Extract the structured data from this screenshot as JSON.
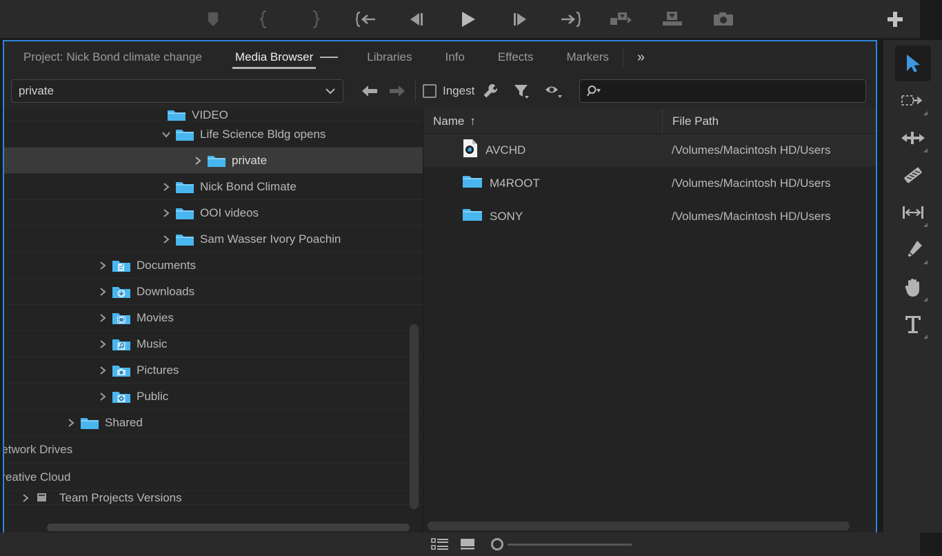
{
  "transport": {
    "buttons": [
      {
        "name": "add-marker-button",
        "icon": "marker-icon"
      },
      {
        "name": "mark-in-button",
        "icon": "mark-in-icon"
      },
      {
        "name": "mark-out-button",
        "icon": "mark-out-icon"
      },
      {
        "name": "go-to-in-button",
        "icon": "go-to-in-icon"
      },
      {
        "name": "step-back-button",
        "icon": "step-back-icon"
      },
      {
        "name": "play-stop-button",
        "icon": "play-icon"
      },
      {
        "name": "step-forward-button",
        "icon": "step-forward-icon"
      },
      {
        "name": "go-to-out-button",
        "icon": "go-to-out-icon"
      },
      {
        "name": "insert-button",
        "icon": "insert-icon"
      },
      {
        "name": "overwrite-button",
        "icon": "overwrite-icon"
      },
      {
        "name": "export-frame-button",
        "icon": "camera-icon"
      }
    ],
    "plus_label": "+"
  },
  "panel": {
    "tabs": [
      {
        "label": "Project: Nick Bond climate change",
        "active": false
      },
      {
        "label": "Media Browser",
        "active": true
      },
      {
        "label": "Libraries",
        "active": false
      },
      {
        "label": "Info",
        "active": false
      },
      {
        "label": "Effects",
        "active": false
      },
      {
        "label": "Markers",
        "active": false
      }
    ],
    "overflow_label": "»",
    "focus_border_color": "#2d85e0"
  },
  "toolbar": {
    "path_value": "private",
    "path_caret": "⌄",
    "back_label": "Back",
    "forward_label": "Forward",
    "ingest_label": "Ingest",
    "ingest_checked": false,
    "wrench_label": "Ingest Settings",
    "filter_label": "Filter by type",
    "eye_label": "Show hidden",
    "search_placeholder": ""
  },
  "tree": {
    "items": [
      {
        "label": "VIDEO",
        "indent": 9,
        "twisty": "down",
        "icon": "folder-blue",
        "selected": false,
        "clipped": true
      },
      {
        "label": "Life Science Bldg opens",
        "indent": 8,
        "twisty": "down",
        "icon": "folder-blue",
        "selected": false
      },
      {
        "label": "private",
        "indent": 9,
        "twisty": "right",
        "icon": "folder-blue",
        "selected": true
      },
      {
        "label": "Nick Bond Climate",
        "indent": 8,
        "twisty": "right",
        "icon": "folder-blue",
        "selected": false
      },
      {
        "label": "OOI videos",
        "indent": 8,
        "twisty": "right",
        "icon": "folder-blue",
        "selected": false
      },
      {
        "label": "Sam Wasser Ivory Poachin",
        "indent": 8,
        "twisty": "right",
        "icon": "folder-blue",
        "selected": false
      },
      {
        "label": "Documents",
        "indent": 5,
        "twisty": "right",
        "icon": "folder-documents",
        "selected": false
      },
      {
        "label": "Downloads",
        "indent": 5,
        "twisty": "right",
        "icon": "folder-downloads",
        "selected": false
      },
      {
        "label": "Movies",
        "indent": 5,
        "twisty": "right",
        "icon": "folder-movies",
        "selected": false
      },
      {
        "label": "Music",
        "indent": 5,
        "twisty": "right",
        "icon": "folder-music",
        "selected": false
      },
      {
        "label": "Pictures",
        "indent": 5,
        "twisty": "right",
        "icon": "folder-pictures",
        "selected": false
      },
      {
        "label": "Public",
        "indent": 5,
        "twisty": "right",
        "icon": "folder-public",
        "selected": false
      },
      {
        "label": "Shared",
        "indent": 3,
        "twisty": "right",
        "icon": "folder-blue",
        "selected": false
      }
    ],
    "sections": [
      {
        "label": "Network Drives"
      },
      {
        "label": "Creative Cloud"
      }
    ],
    "partial_bottom": {
      "label": "Team Projects Versions",
      "icon": "team-projects-icon"
    }
  },
  "list": {
    "columns": [
      {
        "label": "Name",
        "sort": "↑"
      },
      {
        "label": "File Path",
        "sort": ""
      }
    ],
    "rows": [
      {
        "name": "AVCHD",
        "icon": "avchd-file-icon",
        "path": "/Volumes/Macintosh HD/Users",
        "selected": true
      },
      {
        "name": "M4ROOT",
        "icon": "folder-blue",
        "path": "/Volumes/Macintosh HD/Users",
        "selected": false
      },
      {
        "name": "SONY",
        "icon": "folder-blue",
        "path": "/Volumes/Macintosh HD/Users",
        "selected": false
      }
    ]
  },
  "statusbar": {
    "list_view_label": "List View",
    "icon_view_label": "Icon View",
    "zoom_level": 0
  },
  "tools": [
    {
      "name": "selection-tool",
      "icon": "arrow-cursor-icon",
      "active": true,
      "corner": false
    },
    {
      "name": "track-select-forward-tool",
      "icon": "track-select-icon",
      "active": false,
      "corner": true
    },
    {
      "name": "ripple-edit-tool",
      "icon": "ripple-edit-icon",
      "active": false,
      "corner": true
    },
    {
      "name": "razor-tool",
      "icon": "razor-icon",
      "active": false,
      "corner": false
    },
    {
      "name": "slip-tool",
      "icon": "slip-icon",
      "active": false,
      "corner": true
    },
    {
      "name": "pen-tool",
      "icon": "pen-icon",
      "active": false,
      "corner": true
    },
    {
      "name": "hand-tool",
      "icon": "hand-icon",
      "active": false,
      "corner": true
    },
    {
      "name": "type-tool",
      "icon": "type-icon",
      "active": false,
      "corner": true
    }
  ]
}
